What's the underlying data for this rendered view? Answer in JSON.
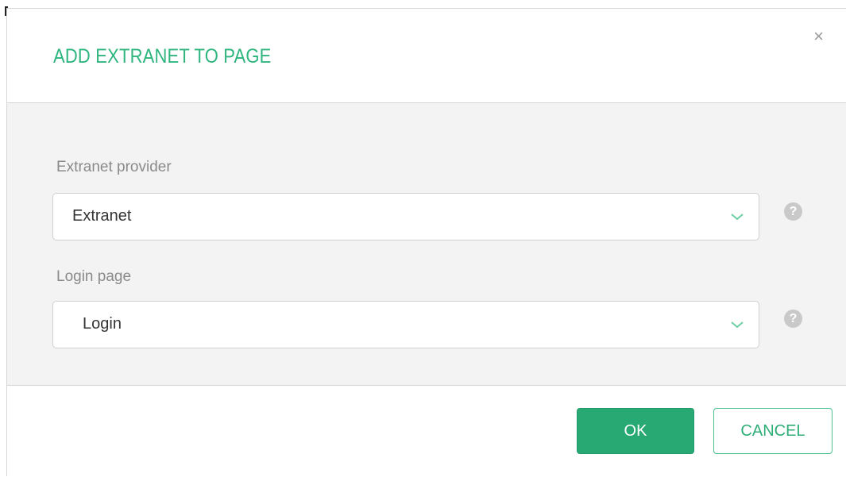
{
  "dialog": {
    "title": "ADD EXTRANET TO PAGE",
    "close_label": "×"
  },
  "fields": [
    {
      "label": "Extranet provider",
      "value": "Extranet",
      "help_icon": "?"
    },
    {
      "label": "Login page",
      "value": "Login",
      "help_icon": "?"
    }
  ],
  "buttons": {
    "ok_label": "OK",
    "cancel_label": "CANCEL"
  },
  "colors": {
    "accent": "#2fb57e",
    "ok_background": "#28a872",
    "body_background": "#f3f3f3"
  },
  "icons": {
    "close": "close-icon",
    "dropdown": "chevron-down-icon",
    "help": "help-icon"
  }
}
